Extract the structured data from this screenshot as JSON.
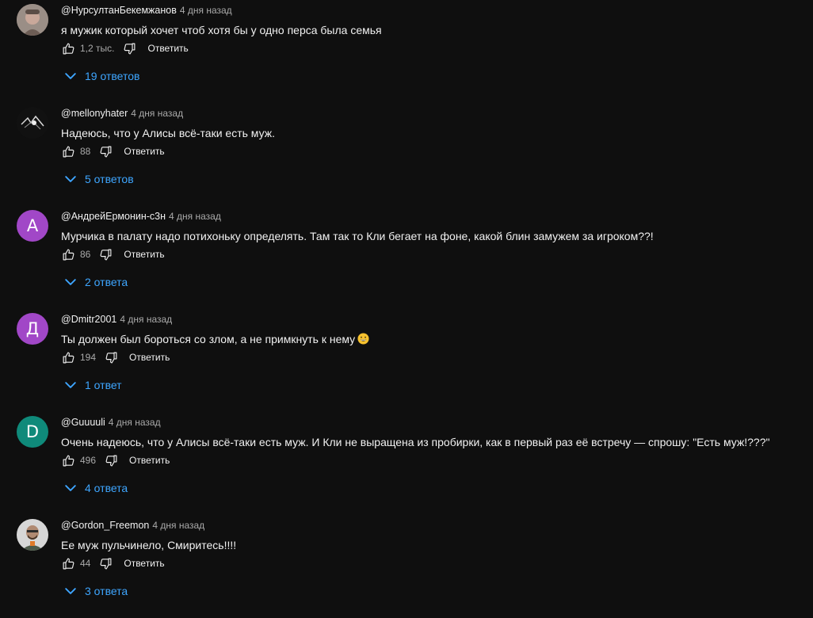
{
  "comments": [
    {
      "author": "@НурсултанБекемжанов",
      "time": "4 дня назад",
      "text": "я мужик который хочет чтоб хотя бы у одно перса была семья",
      "likes": "1,2 тыс.",
      "reply_label": "Ответить",
      "replies_label": "19 ответов",
      "avatar": {
        "type": "photo",
        "color": "#8a7a72",
        "icon": "user-photo"
      }
    },
    {
      "author": "@mellonyhater",
      "time": "4 дня назад",
      "text": "Надеюсь, что у Алисы всё-таки есть муж.",
      "likes": "88",
      "reply_label": "Ответить",
      "replies_label": "5 ответов",
      "avatar": {
        "type": "photo",
        "color": "#151515",
        "icon": "dark-photo"
      }
    },
    {
      "author": "@АндрейЕрмонин-с3н",
      "time": "4 дня назад",
      "text": "Мурчика в палату надо потихоньку определять. Там так то Кли бегает на фоне, какой блин замужем за игроком??!",
      "likes": "86",
      "reply_label": "Ответить",
      "replies_label": "2 ответа",
      "avatar": {
        "type": "letter",
        "letter": "А",
        "color": "#a147c7"
      }
    },
    {
      "author": "@Dmitr2001",
      "time": "4 дня назад",
      "text": "Ты должен был бороться со злом, а не примкнуть к нему",
      "emoji": "grinning-face-emoji",
      "likes": "194",
      "reply_label": "Ответить",
      "replies_label": "1 ответ",
      "avatar": {
        "type": "letter",
        "letter": "Д",
        "color": "#a147c7"
      }
    },
    {
      "author": "@Guuuuli",
      "time": "4 дня назад",
      "text": "Очень надеюсь, что у Алисы всё-таки есть муж. И Кли не выращена из пробирки, как в первый раз её встречу — спрошу: \"Есть муж!???\"",
      "likes": "496",
      "reply_label": "Ответить",
      "replies_label": "4 ответа",
      "avatar": {
        "type": "letter",
        "letter": "D",
        "color": "#0f8a7a"
      }
    },
    {
      "author": "@Gordon_Freemon",
      "time": "4 дня назад",
      "text": "Ее муж пульчинело, Смиритесь!!!!",
      "likes": "44",
      "reply_label": "Ответить",
      "replies_label": "3 ответа",
      "avatar": {
        "type": "photo",
        "color": "#3b3b3b",
        "icon": "gordon-photo"
      }
    }
  ],
  "colors": {
    "background": "#0f0f0f",
    "text": "#f1f1f1",
    "secondary_text": "#aaaaaa",
    "link": "#3ea6ff"
  }
}
